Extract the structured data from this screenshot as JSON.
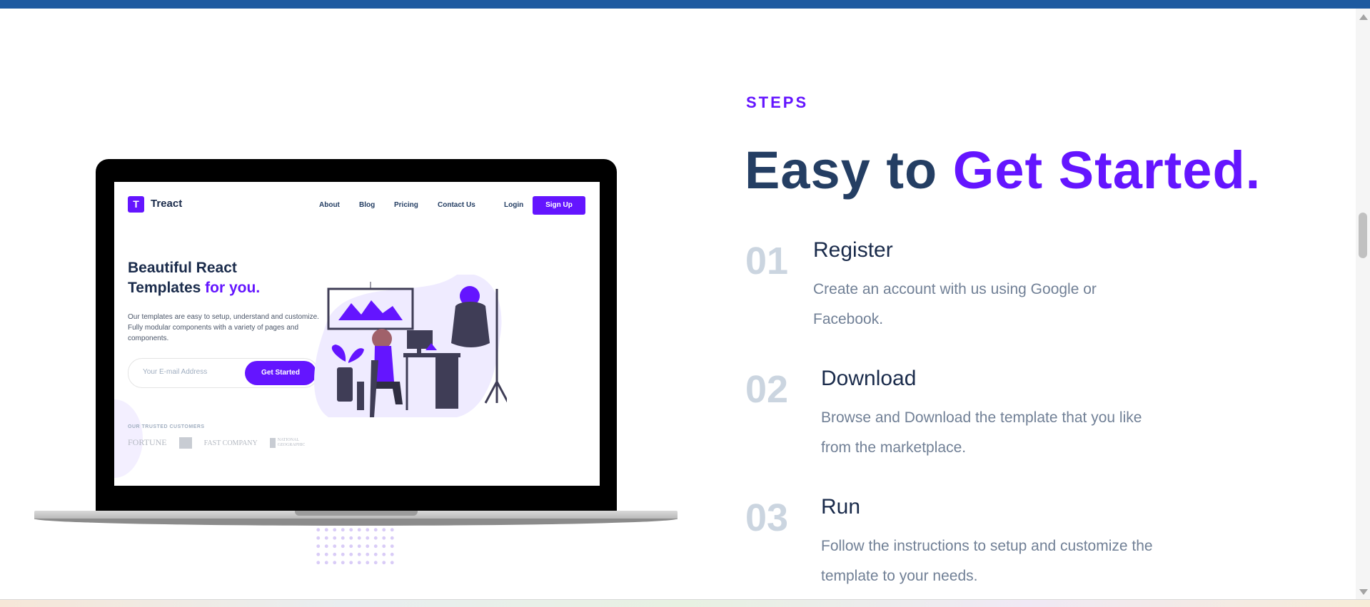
{
  "laptop_preview": {
    "brand": "Treact",
    "logo_letter": "T",
    "nav": [
      "About",
      "Blog",
      "Pricing",
      "Contact Us"
    ],
    "login": "Login",
    "signup": "Sign Up",
    "headline_main": "Beautiful React Templates ",
    "headline_accent": "for you.",
    "description": "Our templates are easy to setup, understand and customize. Fully modular components with a variety of pages and components.",
    "email_placeholder": "Your E-mail Address",
    "cta": "Get Started",
    "trusted_label": "OUR TRUSTED CUSTOMERS",
    "customer_logos": [
      "FORTUNE",
      "FAST COMPANY",
      "NATIONAL GEOGRAPHIC"
    ]
  },
  "section": {
    "label": "STEPS",
    "heading_main": "Easy to ",
    "heading_accent": "Get Started.",
    "steps": [
      {
        "number": "01",
        "title": "Register",
        "description": "Create an account with us using Google or Facebook."
      },
      {
        "number": "02",
        "title": "Download",
        "description": "Browse and Download the template that you like from the marketplace."
      },
      {
        "number": "03",
        "title": "Run",
        "description": "Follow the instructions to setup and customize the template to your needs."
      }
    ]
  },
  "colors": {
    "accent": "#6415ff",
    "heading": "#243e63",
    "muted_number": "#cbd5e0",
    "top_bar": "#1e5aa0"
  }
}
